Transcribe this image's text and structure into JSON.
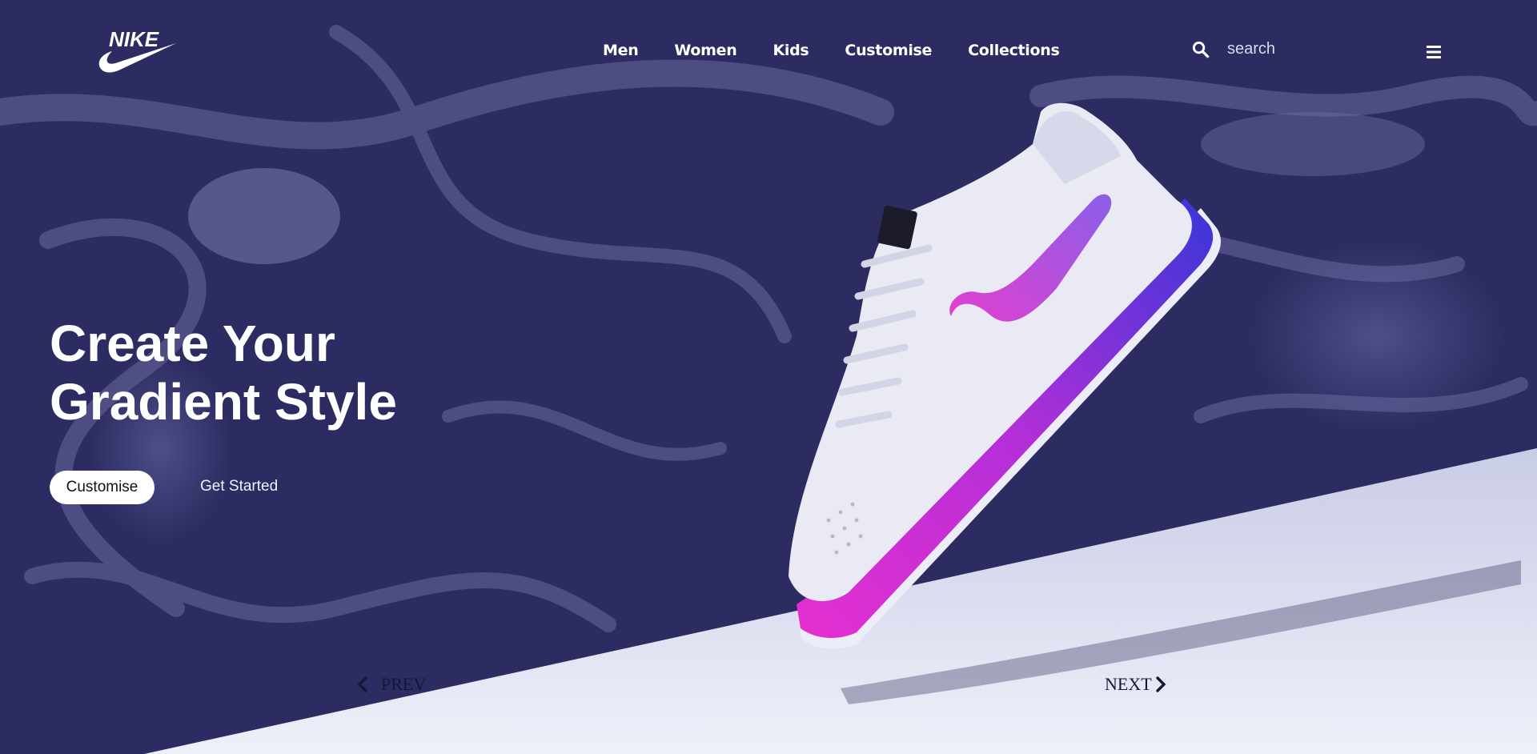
{
  "nav": {
    "logo_text": "NIKE",
    "links": [
      "Men",
      "Women",
      "Kids",
      "Customise",
      "Collections"
    ],
    "search_placeholder": "search"
  },
  "icons": {
    "logo": "nike-swoosh-logo",
    "search": "search-icon",
    "menu": "hamburger-menu-icon",
    "prev": "chevron-left-icon",
    "next": "chevron-right-icon"
  },
  "hero": {
    "title_line1": "Create Your",
    "title_line2": "Gradient Style",
    "primary_button": "Customise",
    "secondary_button": "Get Started"
  },
  "pager": {
    "prev": "PREV",
    "next": "NEXT"
  },
  "colors": {
    "background": "#2c2c62",
    "floor": "#e6e8f4",
    "text": "#ffffff",
    "pager_text": "#161636",
    "sole_gradient": [
      "#e62fcf",
      "#b22fd8",
      "#3836d8"
    ]
  }
}
